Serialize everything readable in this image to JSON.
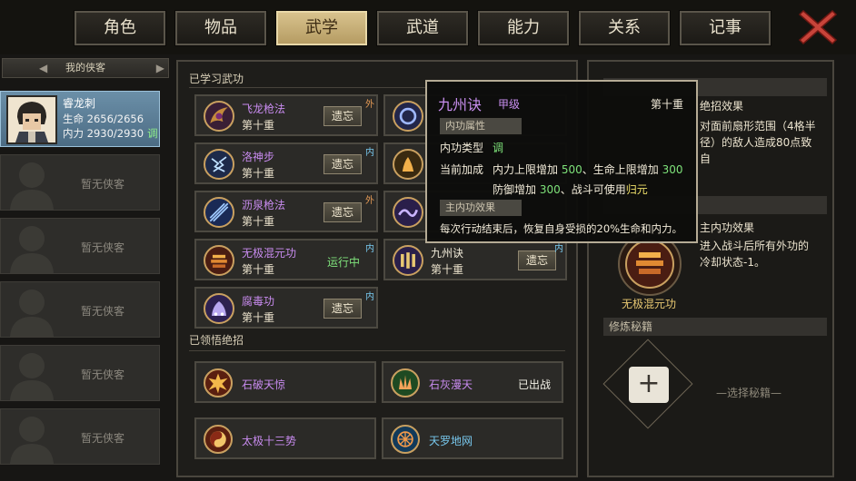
{
  "tabs": [
    {
      "label": "角色",
      "active": false
    },
    {
      "label": "物品",
      "active": false
    },
    {
      "label": "武学",
      "active": true
    },
    {
      "label": "武道",
      "active": false
    },
    {
      "label": "能力",
      "active": false
    },
    {
      "label": "关系",
      "active": false
    },
    {
      "label": "记事",
      "active": false
    }
  ],
  "party": {
    "header": "我的侠客",
    "hero": {
      "name": "睿龙刺",
      "hp_label": "生命",
      "hp": "2656/2656",
      "mp_label": "内力",
      "mp": "2930/2930",
      "mp_tag": "调"
    },
    "empty_label": "暂无侠客"
  },
  "learned": {
    "title": "已学习武功",
    "forget_label": "遗忘",
    "skills": [
      {
        "name": "飞龙枪法",
        "level": "第十重",
        "tag": "外",
        "action": "forget",
        "icon": "dragon-spear-icon"
      },
      {
        "name": "洛神步",
        "level": "第十重",
        "tag": "内",
        "action": "forget",
        "icon": "lightning-step-icon"
      },
      {
        "name": "沥泉枪法",
        "level": "第十重",
        "tag": "外",
        "action": "forget",
        "icon": "spring-spear-icon"
      },
      {
        "name": "无极混元功",
        "level": "第十重",
        "tag": "内",
        "action": "running",
        "status": "运行中",
        "icon": "altar-icon"
      },
      {
        "name": "九州诀",
        "level": "第十重",
        "tag": "内",
        "action": "forget",
        "icon": "pillars-icon"
      },
      {
        "name": "腐毒功",
        "level": "第十重",
        "tag": "内",
        "action": "forget",
        "icon": "poison-icon"
      }
    ]
  },
  "moves": {
    "title": "已领悟绝招",
    "items": [
      {
        "name": "石破天惊",
        "color": "#c88bef",
        "status": "",
        "icon": "stone-burst-icon"
      },
      {
        "name": "石灰漫天",
        "color": "#c88bef",
        "status": "已出战",
        "icon": "lime-cloud-icon"
      },
      {
        "name": "太极十三势",
        "color": "#c88bef",
        "status": "",
        "icon": "taiji-icon"
      },
      {
        "name": "天罗地网",
        "color": "#78c8ee",
        "status": "",
        "icon": "net-icon"
      }
    ]
  },
  "detail": {
    "move_effect_title": "绝招效果",
    "move_effect_text": [
      "对面前扇形范围（4格半",
      "径）的敌人造成80点致",
      "自"
    ],
    "internal_effect_title": "主内功效果",
    "internal_effect_text": [
      "进入战斗后所有外功的",
      "冷却状态-1。"
    ],
    "internal_skill_name": "无极混元功",
    "manual_header": "修炼秘籍",
    "select_manual": "—选择秘籍—",
    "add_symbol": "+"
  },
  "tooltip": {
    "name": "九州诀",
    "grade": "甲级",
    "level": "第十重",
    "attr_header": "内功属性",
    "type_label": "内功类型",
    "type_value": "调",
    "bonus_label": "当前加成",
    "bonus_line1_a": "内力上限增加 ",
    "bonus_line1_b": "500",
    "bonus_line1_c": "、生命上限增加 ",
    "bonus_line1_d": "300",
    "bonus_line2_a": "防御增加 ",
    "bonus_line2_b": "300",
    "bonus_line2_c": "、战斗可使用",
    "bonus_line2_d": "归元",
    "effect_header": "主内功效果",
    "effect_text": "每次行动结束后，恢复自身受损的20%生命和内力。"
  },
  "colors": {
    "accent_tab": "#c9b27a",
    "selected_slot": "#5b7f98",
    "purple_text": "#c88bef",
    "green_text": "#7fe27b",
    "border": "#4a463e"
  }
}
